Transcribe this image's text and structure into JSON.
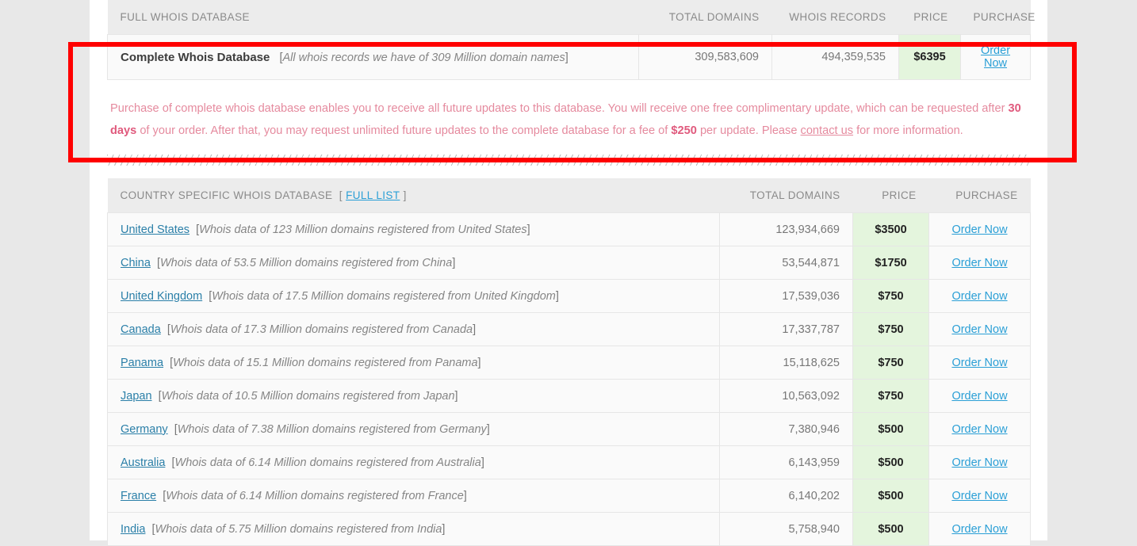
{
  "full_db_table": {
    "headers": {
      "title": "FULL WHOIS DATABASE",
      "total_domains": "TOTAL DOMAINS",
      "whois_records": "WHOIS RECORDS",
      "price": "PRICE",
      "purchase": "PURCHASE"
    },
    "row": {
      "name": "Complete Whois Database",
      "bracket_open": "[",
      "description": "All whois records we have of 309 Million domain names",
      "bracket_close": "]",
      "total_domains": "309,583,609",
      "whois_records": "494,359,535",
      "price": "$6395",
      "order_label": "Order Now"
    }
  },
  "notice": {
    "part1": "Purchase of complete whois database enables you to receive all future updates to this database. You will receive one free complimentary update, which can be requested after ",
    "bold1": "30 days",
    "part2": " of your order. After that, you may request unlimited future updates to the complete database for a fee of ",
    "bold2": "$250",
    "part3": " per update. Please ",
    "link": "contact us",
    "part4": " for more information."
  },
  "country_table": {
    "headers": {
      "title": "COUNTRY SPECIFIC WHOIS DATABASE",
      "bracket_open": "[",
      "full_list_link": "FULL LIST",
      "bracket_close": "]",
      "total_domains": "TOTAL DOMAINS",
      "price": "PRICE",
      "purchase": "PURCHASE"
    },
    "order_label": "Order Now",
    "rows": [
      {
        "country": "United States",
        "description": "Whois data of 123 Million domains registered from United States",
        "total_domains": "123,934,669",
        "price": "$3500"
      },
      {
        "country": "China",
        "description": "Whois data of 53.5 Million domains registered from China",
        "total_domains": "53,544,871",
        "price": "$1750"
      },
      {
        "country": "United Kingdom",
        "description": "Whois data of 17.5 Million domains registered from United Kingdom",
        "total_domains": "17,539,036",
        "price": "$750"
      },
      {
        "country": "Canada",
        "description": "Whois data of 17.3 Million domains registered from Canada",
        "total_domains": "17,337,787",
        "price": "$750"
      },
      {
        "country": "Panama",
        "description": "Whois data of 15.1 Million domains registered from Panama",
        "total_domains": "15,118,625",
        "price": "$750"
      },
      {
        "country": "Japan",
        "description": "Whois data of 10.5 Million domains registered from Japan",
        "total_domains": "10,563,092",
        "price": "$750"
      },
      {
        "country": "Germany",
        "description": "Whois data of 7.38 Million domains registered from Germany",
        "total_domains": "7,380,946",
        "price": "$500"
      },
      {
        "country": "Australia",
        "description": "Whois data of 6.14 Million domains registered from Australia",
        "total_domains": "6,143,959",
        "price": "$500"
      },
      {
        "country": "France",
        "description": "Whois data of 6.14 Million domains registered from France",
        "total_domains": "6,140,202",
        "price": "$500"
      },
      {
        "country": "India",
        "description": "Whois data of 5.75 Million domains registered from India",
        "total_domains": "5,758,940",
        "price": "$500"
      }
    ]
  },
  "colors": {
    "accent_link": "#2a9fd6",
    "price_bg": "#e4f5dd",
    "notice_text": "#e58a9e",
    "annotation": "#ff0000",
    "page_bg": "#e8e8e8"
  }
}
